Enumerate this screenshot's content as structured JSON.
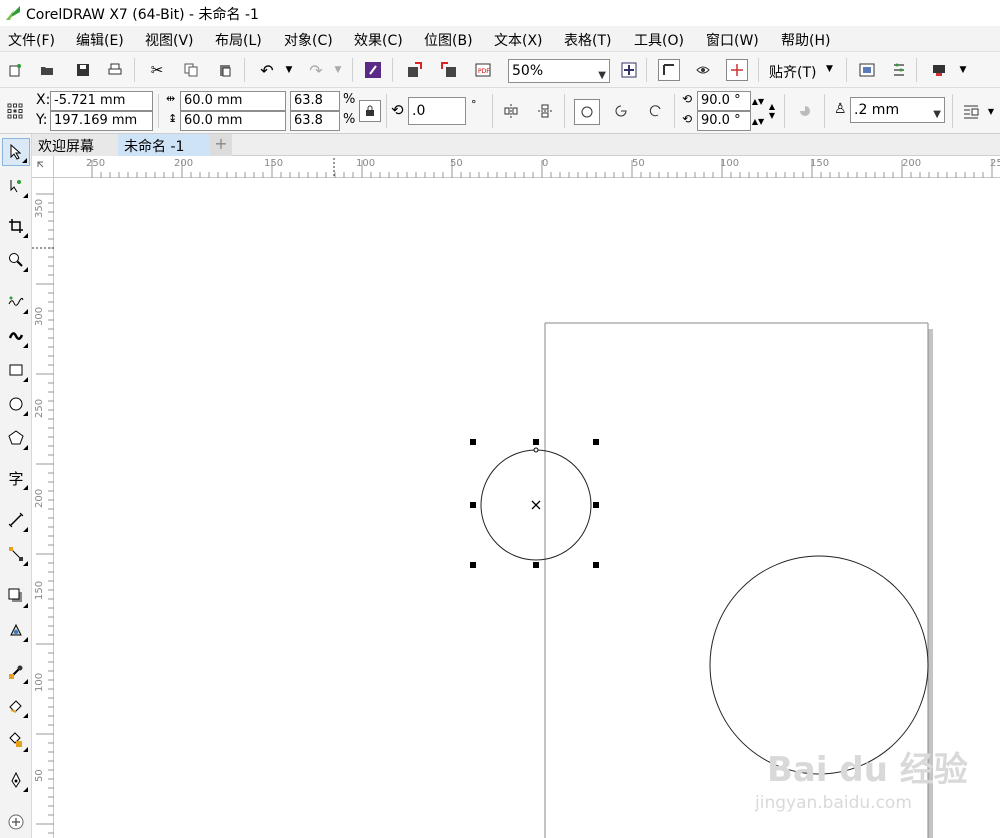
{
  "window": {
    "title": "CorelDRAW X7 (64-Bit) - 未命名 -1"
  },
  "menu": {
    "items": [
      "文件(F)",
      "编辑(E)",
      "视图(V)",
      "布局(L)",
      "对象(C)",
      "效果(C)",
      "位图(B)",
      "文本(X)",
      "表格(T)",
      "工具(O)",
      "窗口(W)",
      "帮助(H)"
    ]
  },
  "toolbar": {
    "zoom_value": "50%",
    "snap_label": "贴齐(T)"
  },
  "property_bar": {
    "x_label": "X:",
    "x_value": "-5.721 mm",
    "y_label": "Y:",
    "y_value": "197.169 mm",
    "width_value": "60.0 mm",
    "height_value": "60.0 mm",
    "scale_w": "63.8",
    "scale_h": "63.8",
    "pct": "%",
    "rotation_value": ".0",
    "degree": "°",
    "start_angle": "90.0 °",
    "end_angle": "90.0 °",
    "outline_width": ".2 mm"
  },
  "tabs": [
    {
      "label": "欢迎屏幕"
    },
    {
      "label": "未命名 -1"
    }
  ],
  "rulers": {
    "horizontal": [
      "250",
      "200",
      "150",
      "100",
      "50",
      "0",
      "50",
      "100",
      "150",
      "200",
      "25"
    ],
    "vertical": [
      "350",
      "300",
      "250",
      "200",
      "150",
      "100",
      "50"
    ]
  },
  "watermark": {
    "brand": "Bai du 经验",
    "url": "jingyan.baidu.com"
  },
  "colors": {
    "accent": "#2e9b3a",
    "tab_active": "#cfe3f7",
    "page_border": "#888888",
    "page_shadow": "#c4c4c4"
  }
}
